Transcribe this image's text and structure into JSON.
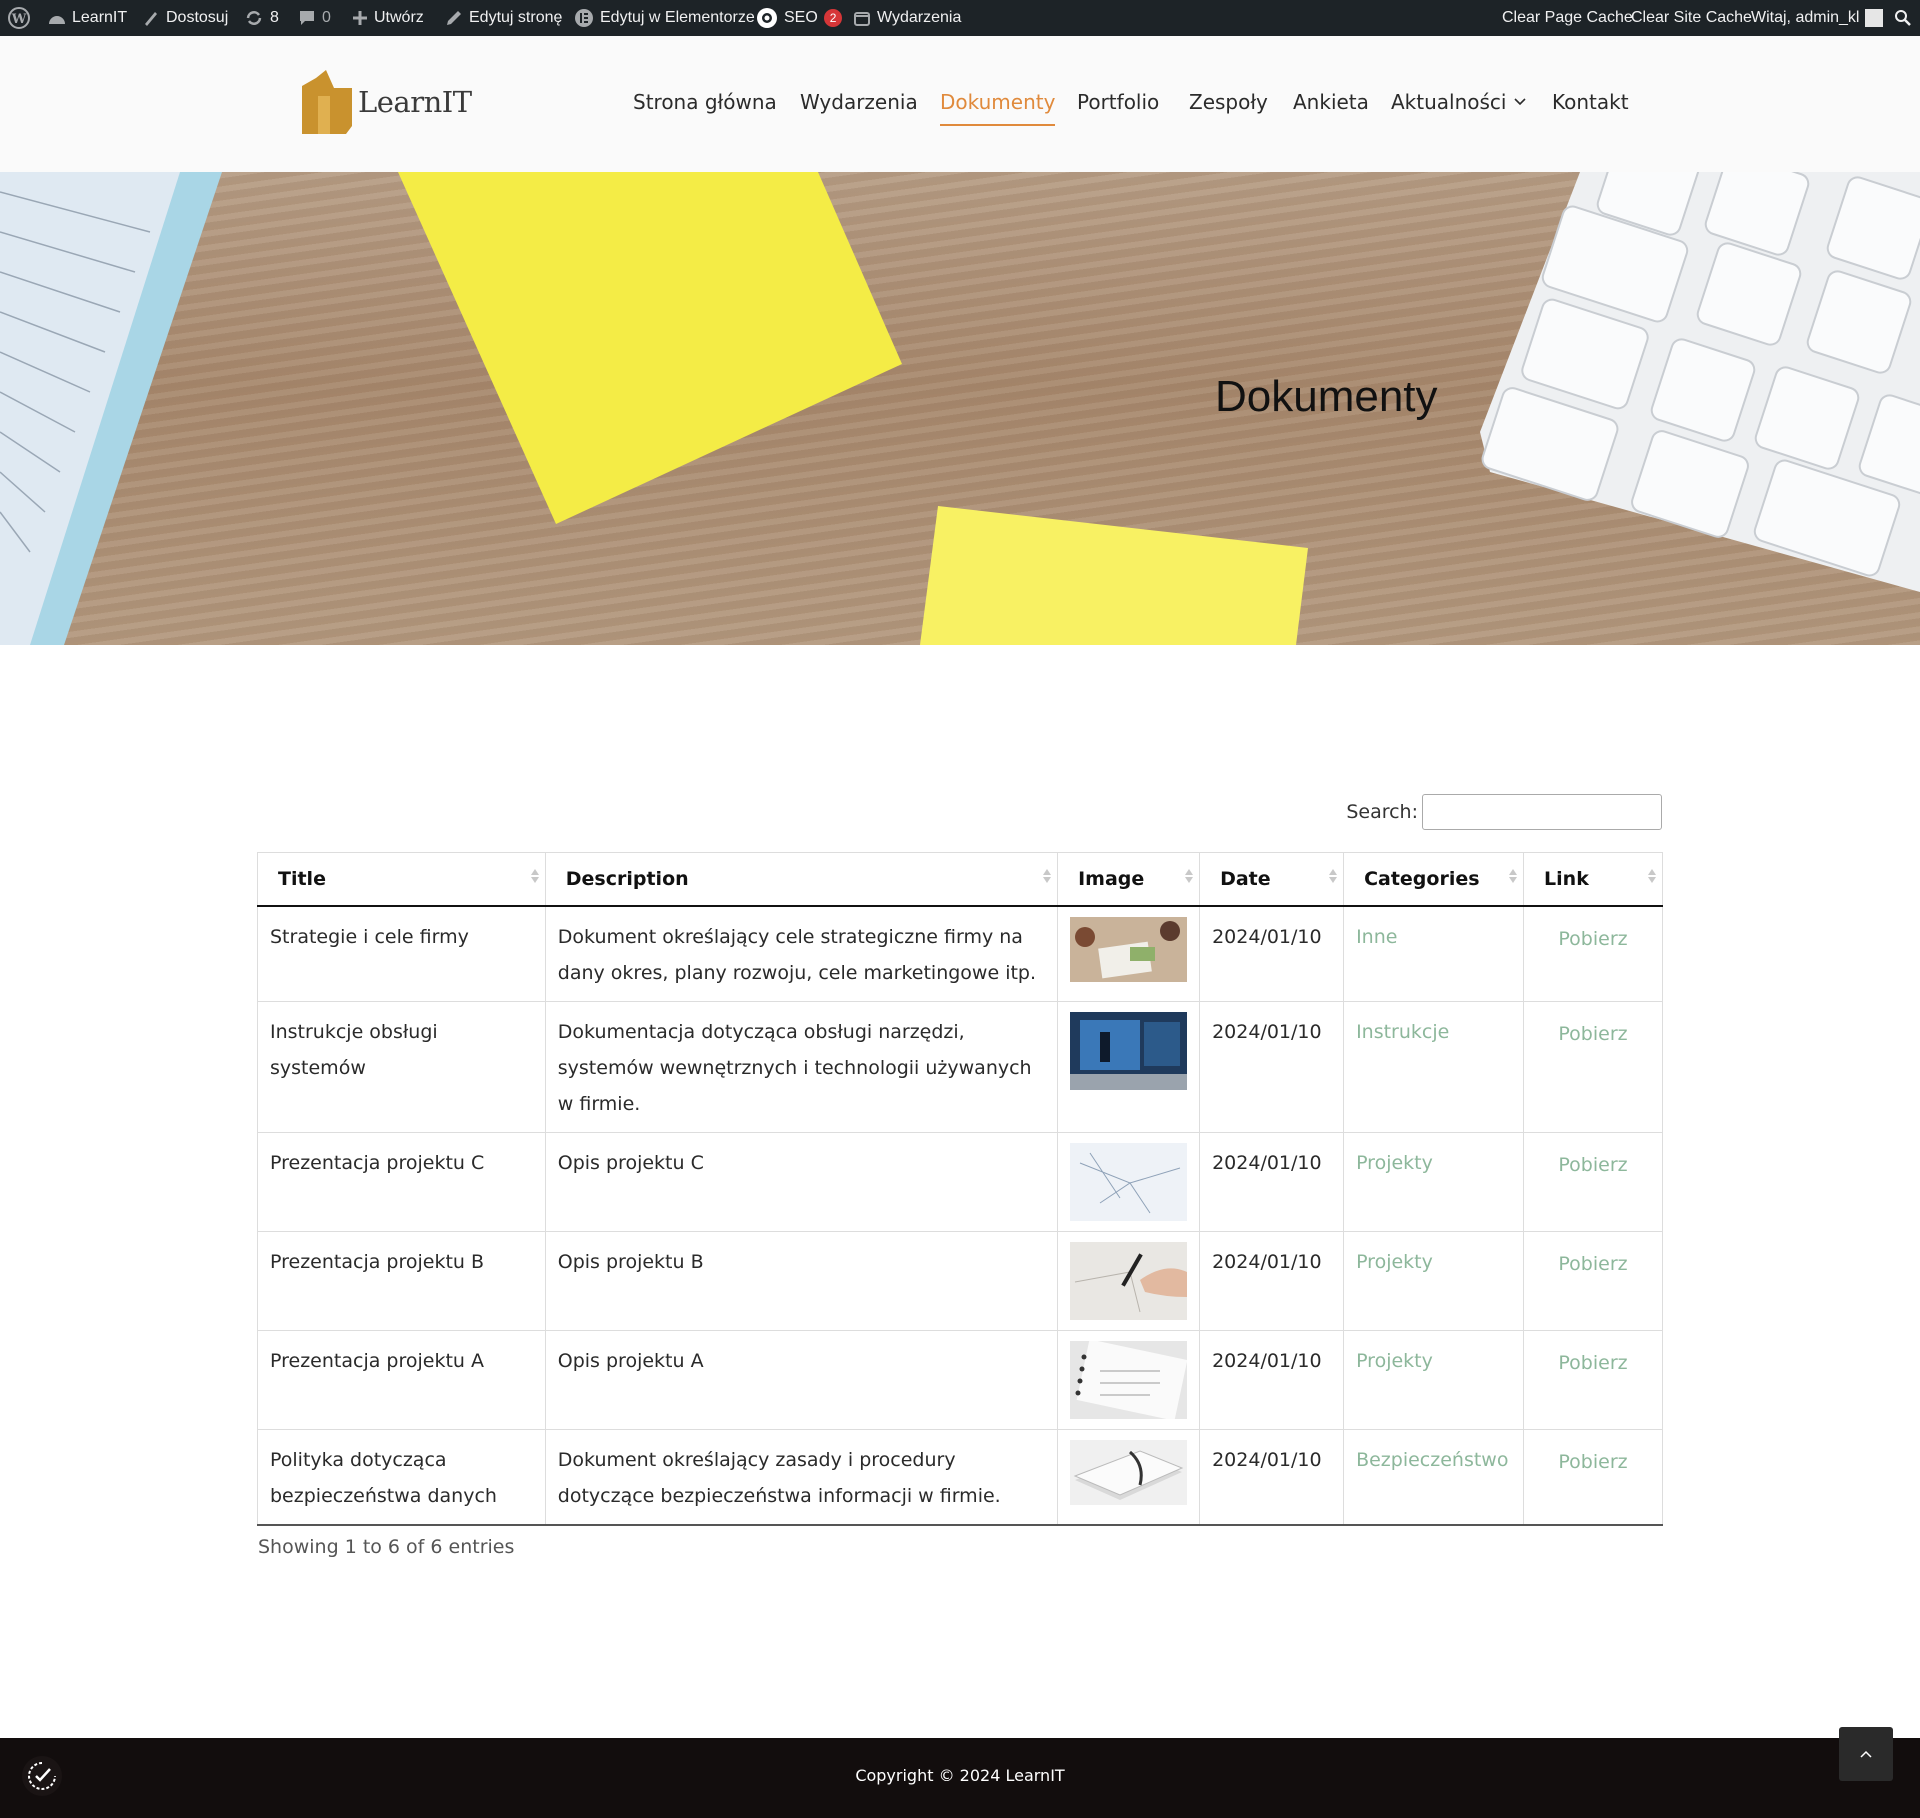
{
  "admin_bar": {
    "site_name": "LearnIT",
    "customize": "Dostosuj",
    "updates_count": "8",
    "comments_count": "0",
    "new": "Utwórz",
    "edit_page": "Edytuj stronę",
    "edit_elementor": "Edytuj w Elementorze",
    "seo": "SEO",
    "seo_badge": "2",
    "events": "Wydarzenia",
    "clear_page_cache": "Clear Page Cache",
    "clear_site_cache": "Clear Site Cache",
    "greeting": "Witaj, admin_kl"
  },
  "header": {
    "logo_text": "LearnIT",
    "nav": [
      {
        "label": "Strona główna"
      },
      {
        "label": "Wydarzenia"
      },
      {
        "label": "Dokumenty"
      },
      {
        "label": "Portfolio"
      },
      {
        "label": "Zespoły"
      },
      {
        "label": "Ankieta"
      },
      {
        "label": "Aktualności"
      },
      {
        "label": "Kontakt"
      }
    ],
    "active_item": "Dokumenty"
  },
  "hero": {
    "title": "Dokumenty"
  },
  "table": {
    "search_label": "Search:",
    "search_value": "",
    "columns": [
      "Title",
      "Description",
      "Image",
      "Date",
      "Categories",
      "Link"
    ],
    "rows": [
      {
        "title": "Strategie i cele firmy",
        "description": "Dokument określający cele strategiczne firmy na dany okres, plany rozwoju, cele marketingowe itp.",
        "image": "business-meeting-thumbnail",
        "date": "2024/01/10",
        "category": "Inne",
        "link": "Pobierz"
      },
      {
        "title": "Instrukcje obsługi systemów",
        "description": "Dokumentacja dotycząca obsługi narzędzi, systemów wewnętrznych i technologii używanych w firmie.",
        "image": "laptop-screen-thumbnail",
        "date": "2024/01/10",
        "category": "Instrukcje",
        "link": "Pobierz"
      },
      {
        "title": "Prezentacja projektu C",
        "description": "Opis projektu C",
        "image": "blueprint-sketch-thumbnail",
        "date": "2024/01/10",
        "category": "Projekty",
        "link": "Pobierz"
      },
      {
        "title": "Prezentacja projektu B",
        "description": "Opis projektu B",
        "image": "hand-drawing-thumbnail",
        "date": "2024/01/10",
        "category": "Projekty",
        "link": "Pobierz"
      },
      {
        "title": "Prezentacja projektu A",
        "description": "Opis projektu A",
        "image": "notebook-thumbnail",
        "date": "2024/01/10",
        "category": "Projekty",
        "link": "Pobierz"
      },
      {
        "title": "Polityka dotycząca bezpieczeństwa danych",
        "description": "Dokument określający zasady i procedury dotyczące bezpieczeństwa informacji w firmie.",
        "image": "paper-stack-thumbnail",
        "date": "2024/01/10",
        "category": "Bezpieczeństwo",
        "link": "Pobierz"
      }
    ],
    "entries_info": "Showing 1 to 6 of 6 entries"
  },
  "footer": {
    "copyright": "Copyright © 2024 LearnIT"
  },
  "colors": {
    "accent": "#e08a3c",
    "link": "#8db79b",
    "admin_bar": "#1d2327",
    "footer": "#120d0d"
  }
}
